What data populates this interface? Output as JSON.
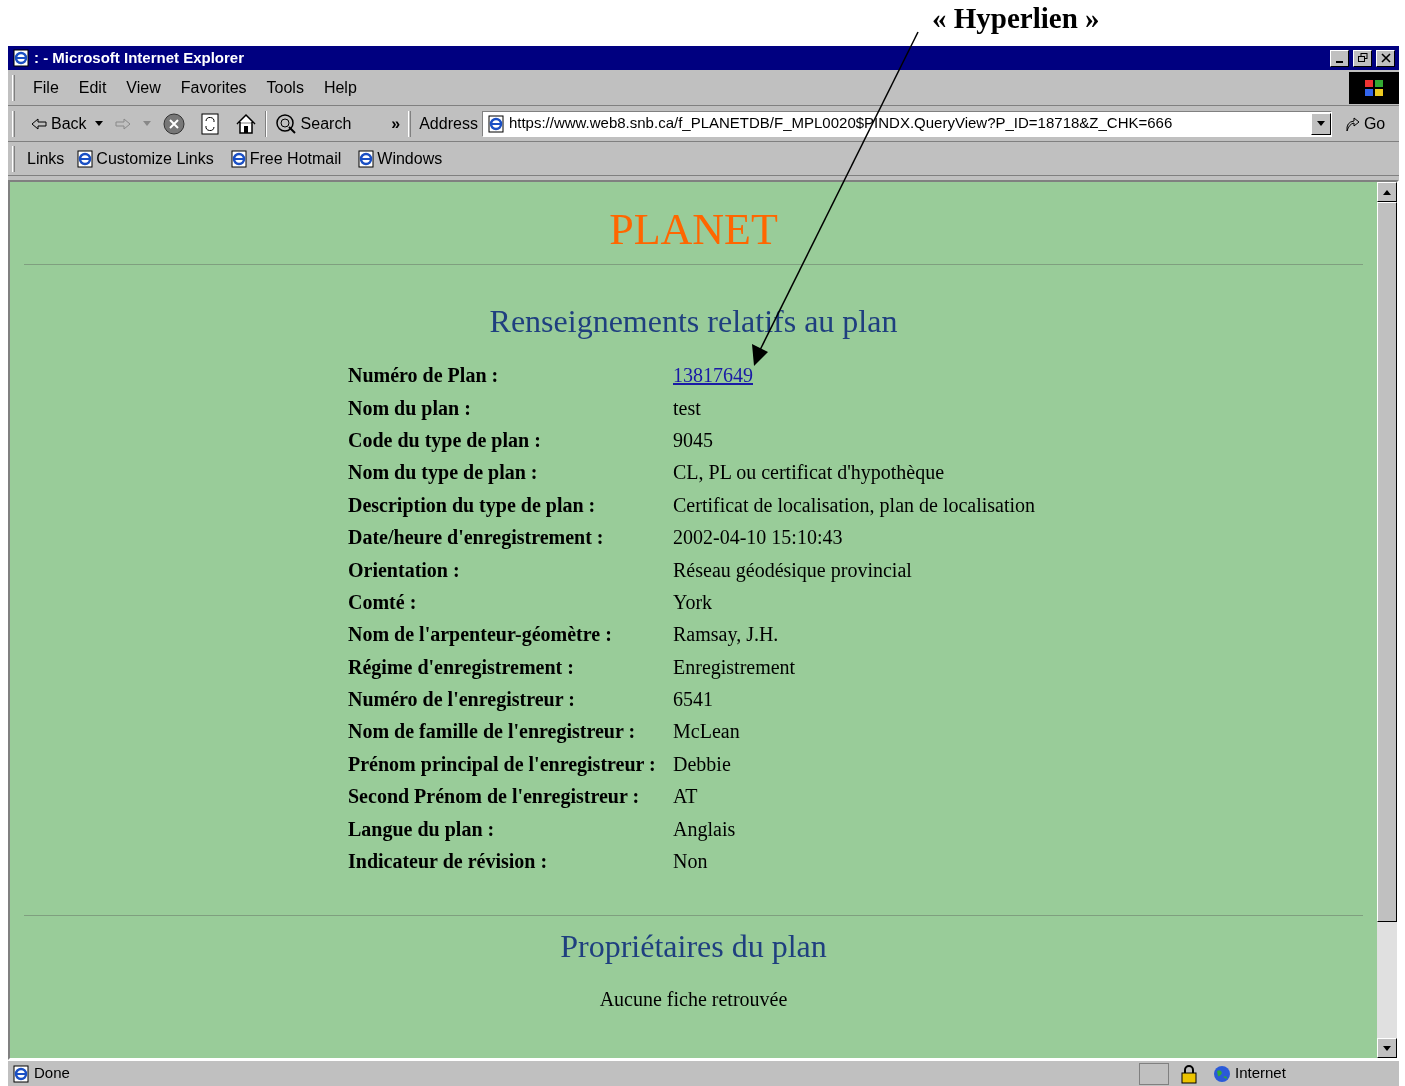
{
  "annotation": {
    "label": "« Hyperlien »"
  },
  "window": {
    "title": ": - Microsoft Internet Explorer"
  },
  "menu": [
    "File",
    "Edit",
    "View",
    "Favorites",
    "Tools",
    "Help"
  ],
  "toolbar": {
    "back": "Back",
    "search": "Search",
    "more": "»",
    "address_label": "Address",
    "address": "https://www.web8.snb.ca/f_PLANETDB/F_MPL0020$PINDX.QueryView?P_ID=18718&Z_CHK=666",
    "go": "Go"
  },
  "links_bar": {
    "label": "Links",
    "items": [
      "Customize Links",
      "Free Hotmail",
      "Windows"
    ]
  },
  "page": {
    "title": "PLANET",
    "section_title": "Renseignements relatifs au plan",
    "fields": [
      {
        "label": "Numéro de Plan :",
        "value": "13817649",
        "kind": "link"
      },
      {
        "label": "Nom du plan :",
        "value": "test",
        "kind": "text"
      },
      {
        "label": "Code du type de plan :",
        "value": "9045",
        "kind": "text"
      },
      {
        "label": "Nom du type de plan :",
        "value": "CL, PL ou certificat d'hypothèque",
        "kind": "text"
      },
      {
        "label": "Description du type de plan :",
        "value": "Certificat de localisation, plan de localisation",
        "kind": "text"
      },
      {
        "label": "Date/heure d'enregistrement :",
        "value": "2002-04-10 15:10:43",
        "kind": "text"
      },
      {
        "label": "Orientation :",
        "value": "Réseau géodésique provincial",
        "kind": "text"
      },
      {
        "label": "Comté :",
        "value": "York",
        "kind": "text"
      },
      {
        "label": "Nom de l'arpenteur-géomètre :",
        "value": "Ramsay, J.H.",
        "kind": "text"
      },
      {
        "label": "Régime d'enregistrement :",
        "value": "Enregistrement",
        "kind": "text"
      },
      {
        "label": "Numéro de l'enregistreur :",
        "value": "6541",
        "kind": "text"
      },
      {
        "label": "Nom de famille de l'enregistreur :",
        "value": "McLean",
        "kind": "text"
      },
      {
        "label": "Prénom principal de l'enregistreur :",
        "value": "Debbie",
        "kind": "text"
      },
      {
        "label": "Second Prénom de l'enregistreur :",
        "value": "AT",
        "kind": "text"
      },
      {
        "label": "Langue du plan :",
        "value": "Anglais",
        "kind": "text"
      },
      {
        "label": "Indicateur de révision :",
        "value": "Non",
        "kind": "text"
      }
    ],
    "owners_title": "Propriétaires du plan",
    "owners_message": "Aucune fiche retrouvée"
  },
  "status_bar": {
    "status": "Done",
    "zone": "Internet"
  }
}
